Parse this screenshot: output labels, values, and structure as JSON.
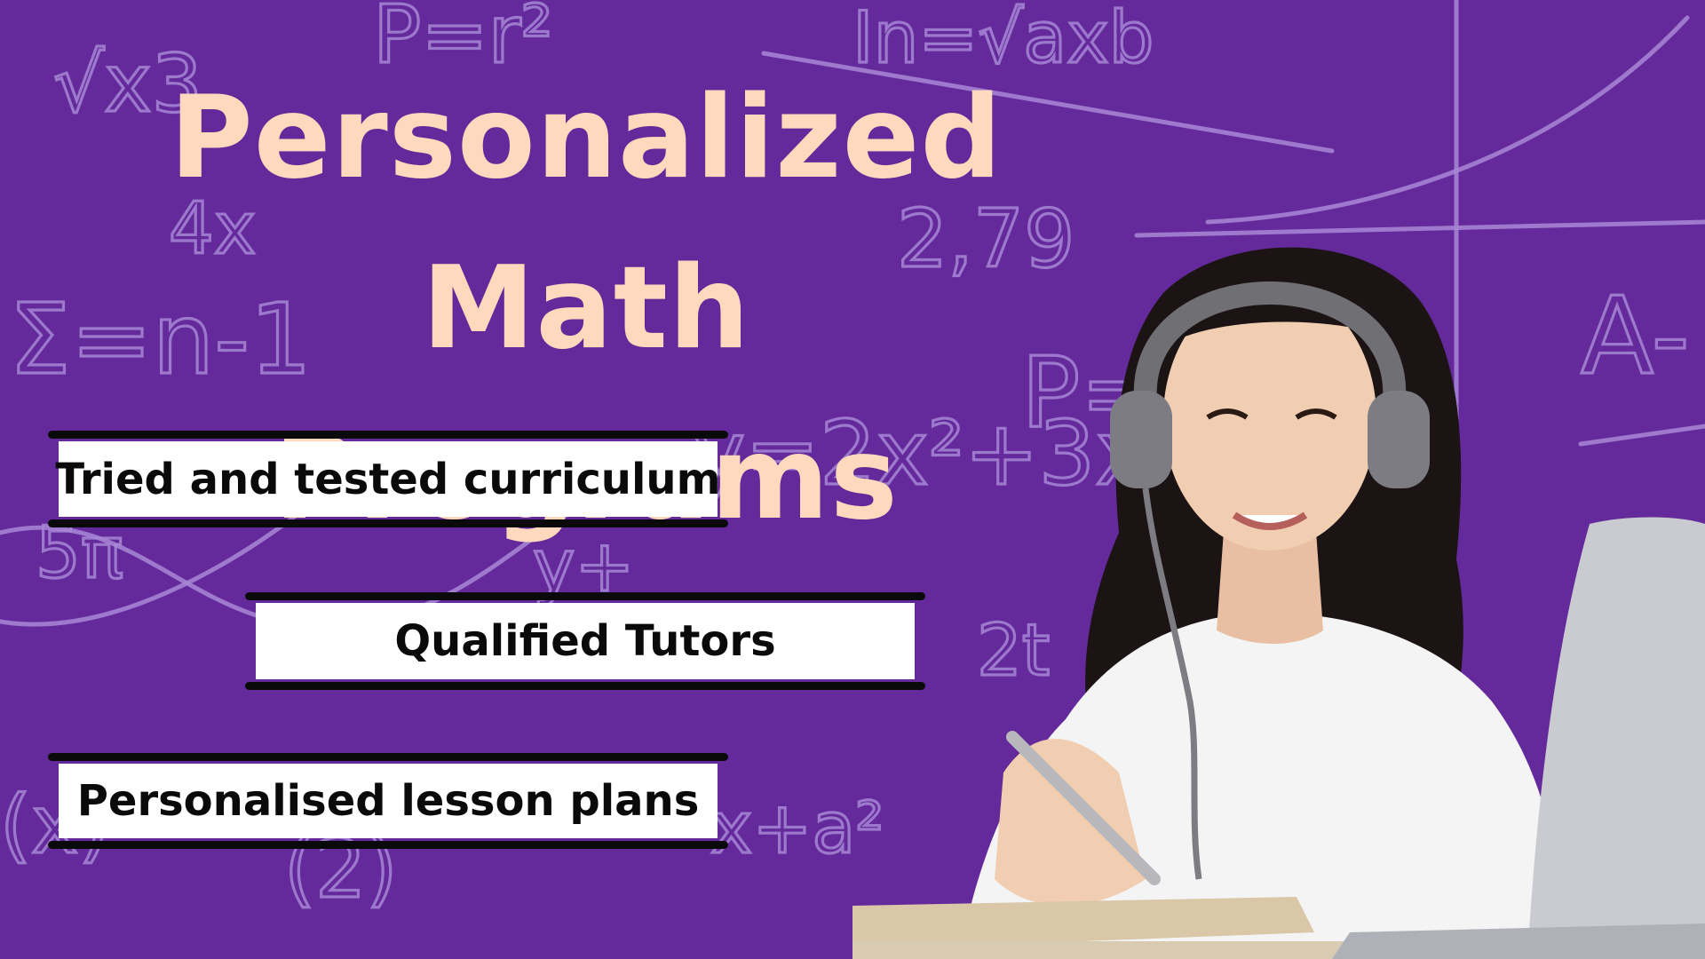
{
  "headline": {
    "line1": "Personalized Math",
    "line2": "Programs"
  },
  "features": [
    {
      "label": "Tried and tested curriculum"
    },
    {
      "label": "Qualified Tutors"
    },
    {
      "label": "Personalised lesson plans"
    }
  ],
  "colors": {
    "background": "#642a9b",
    "chalk": "#a887d6",
    "headline": "#ffd9bd",
    "label_box": "#ffffff",
    "label_text": "#0a0a0a"
  },
  "icons": {
    "photo": "student-with-headphones-image"
  }
}
